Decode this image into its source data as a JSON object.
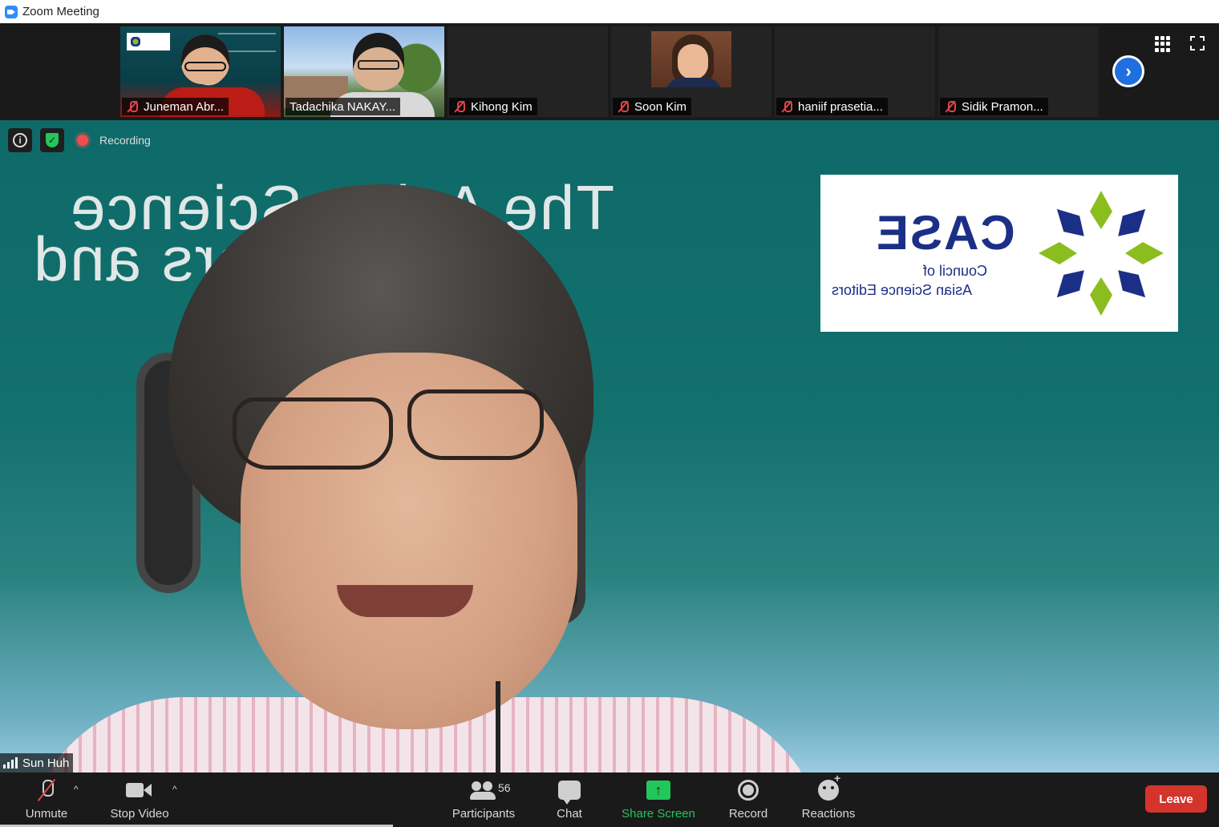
{
  "window": {
    "title": "Zoom Meeting"
  },
  "participants_strip": [
    {
      "name": "Juneman Abr...",
      "muted": true
    },
    {
      "name": "Tadachika NAKAY...",
      "muted": false
    },
    {
      "name": "Kihong Kim",
      "muted": true
    },
    {
      "name": "Soon Kim",
      "muted": true
    },
    {
      "name": "haniif prasetia...",
      "muted": true
    },
    {
      "name": "Sidik Pramon...",
      "muted": true
    }
  ],
  "status": {
    "recording_label": "Recording"
  },
  "slide": {
    "line1": "The Asian Science",
    "line2": "Editors and",
    "logo_word": "CASE",
    "logo_sub1": "Council of",
    "logo_sub2": "Asian Science Editors"
  },
  "speaker": {
    "name": "Sun Huh"
  },
  "toolbar": {
    "unmute": "Unmute",
    "stop_video": "Stop Video",
    "participants": "Participants",
    "participants_count": "56",
    "chat": "Chat",
    "share_screen": "Share Screen",
    "record": "Record",
    "reactions": "Reactions",
    "leave": "Leave"
  },
  "colors": {
    "accent_blue": "#2d8cff",
    "share_green": "#23c65a",
    "leave_red": "#d4342c",
    "slide_teal": "#0e6a68"
  },
  "icons": [
    "zoom-app-icon",
    "mic-off-icon",
    "next-page-icon",
    "gallery-grid-icon",
    "fullscreen-icon",
    "info-icon",
    "shield-icon",
    "record-dot-icon",
    "signal-icon",
    "camera-icon",
    "participants-icon",
    "chat-icon",
    "share-screen-icon",
    "record-icon",
    "reactions-icon"
  ]
}
